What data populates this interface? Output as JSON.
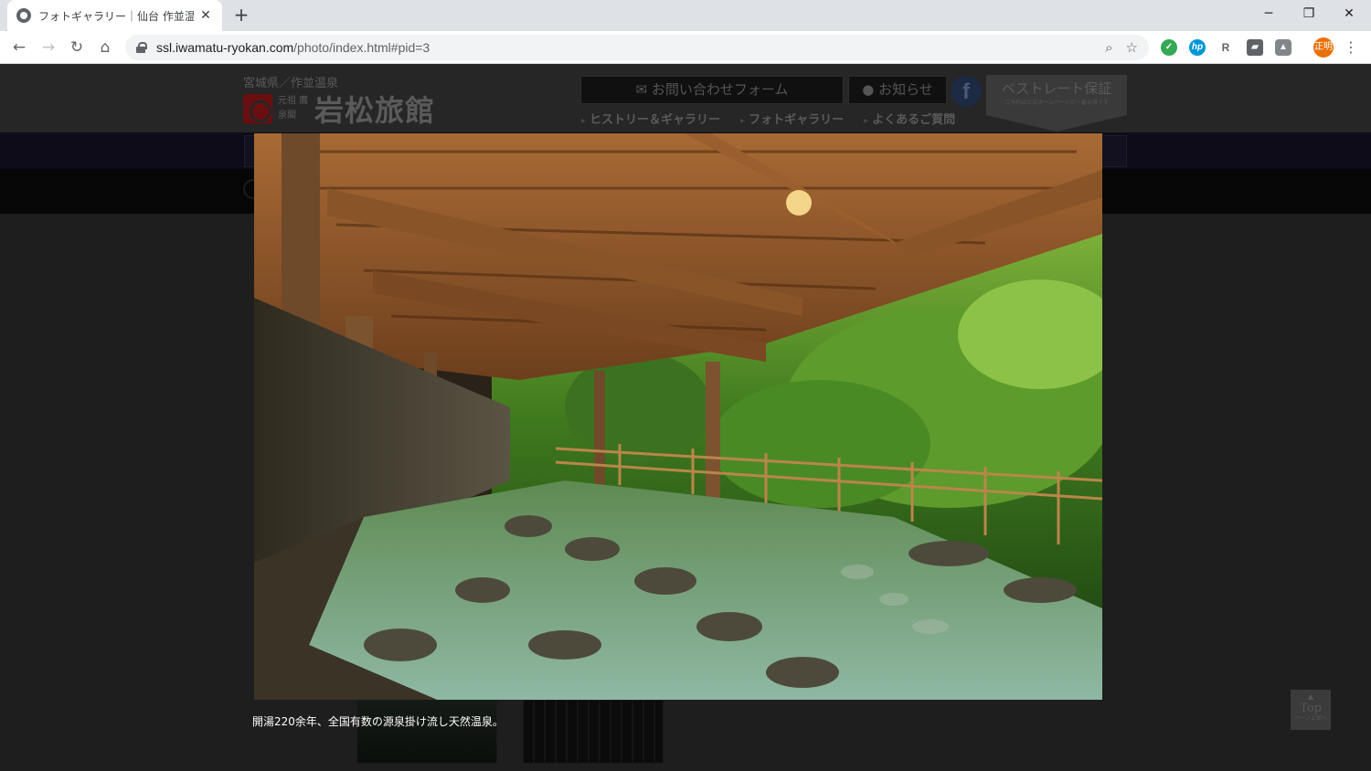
{
  "browser": {
    "tab_title": "フォトギャラリー｜仙台 作並温泉 鷹泉閣",
    "tab_close": "✕",
    "new_tab": "+",
    "window_controls": {
      "minimize": "─",
      "maximize": "❐",
      "close": "✕"
    },
    "nav": {
      "back": "←",
      "forward": "→",
      "reload": "↻",
      "home": "⌂"
    },
    "url_host": "ssl.iwamatu-ryokan.com",
    "url_path": "/photo/index.html#pid=3",
    "omnibox_icons": {
      "zoom": "⌕",
      "bookmark": "☆"
    },
    "extensions": [
      "✓",
      "hp",
      "R",
      "▰",
      "▲"
    ],
    "profile_label": "正明",
    "menu": "⋮"
  },
  "site": {
    "logo_subtitle": "宮城県／作並温泉",
    "logo_small": "元祖 鷹泉閣",
    "logo_name": "岩松旅館",
    "contact_button": "✉ お問い合わせフォーム",
    "news_button": "● お知らせ",
    "facebook_icon": "f",
    "best_rate_title": "ベストレート保証",
    "best_rate_sub": "ご予約は公式ホームページが一番お得です",
    "subnav": [
      "ヒストリー＆ギャラリー",
      "フォトギャラリー",
      "よくあるご質問"
    ],
    "page_top_arrow": "▲",
    "page_top_label": "Top",
    "page_top_sub": "ページ上部へ"
  },
  "lightbox": {
    "caption": "開湯220余年、全国有数の源泉掛け流し天然温泉。"
  },
  "colors": {
    "chrome_tab_strip": "#dee1e6",
    "overlay_background": "#1e1e1e",
    "caption_text": "#ffffff"
  }
}
